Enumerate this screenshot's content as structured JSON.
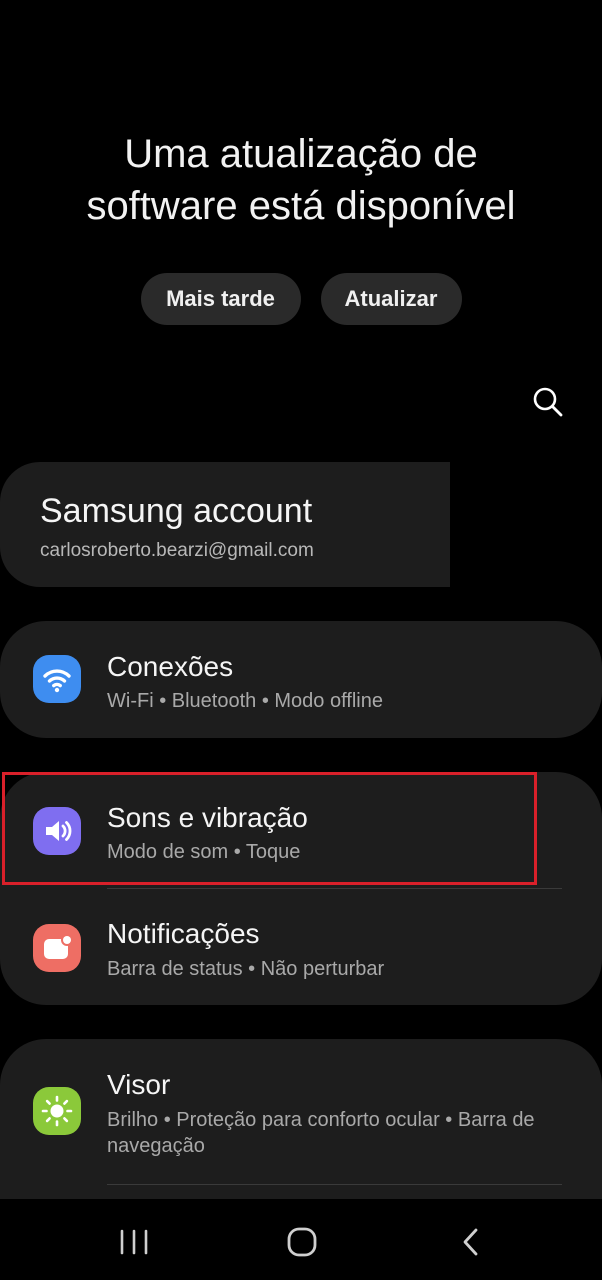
{
  "banner": {
    "title_line1": "Uma atualização de",
    "title_line2": "software está disponível",
    "later_label": "Mais tarde",
    "update_label": "Atualizar"
  },
  "account": {
    "name": "Samsung account",
    "email": "carlosroberto.bearzi@gmail.com"
  },
  "items": [
    {
      "title": "Conexões",
      "subtitle": "Wi-Fi  •  Bluetooth  •  Modo offline",
      "icon": "wifi-icon",
      "color": "#3e8df0"
    },
    {
      "title": "Sons e vibração",
      "subtitle": "Modo de som  •  Toque",
      "icon": "volume-icon",
      "color": "#7f6ef0"
    },
    {
      "title": "Notificações",
      "subtitle": "Barra de status  •  Não perturbar",
      "icon": "notification-icon",
      "color": "#ee6e64"
    },
    {
      "title": "Visor",
      "subtitle": "Brilho  •  Proteção para conforto ocular  •  Barra de navegação",
      "icon": "brightness-icon",
      "color": "#8bc93a"
    }
  ],
  "highlight_color": "#d9202a"
}
